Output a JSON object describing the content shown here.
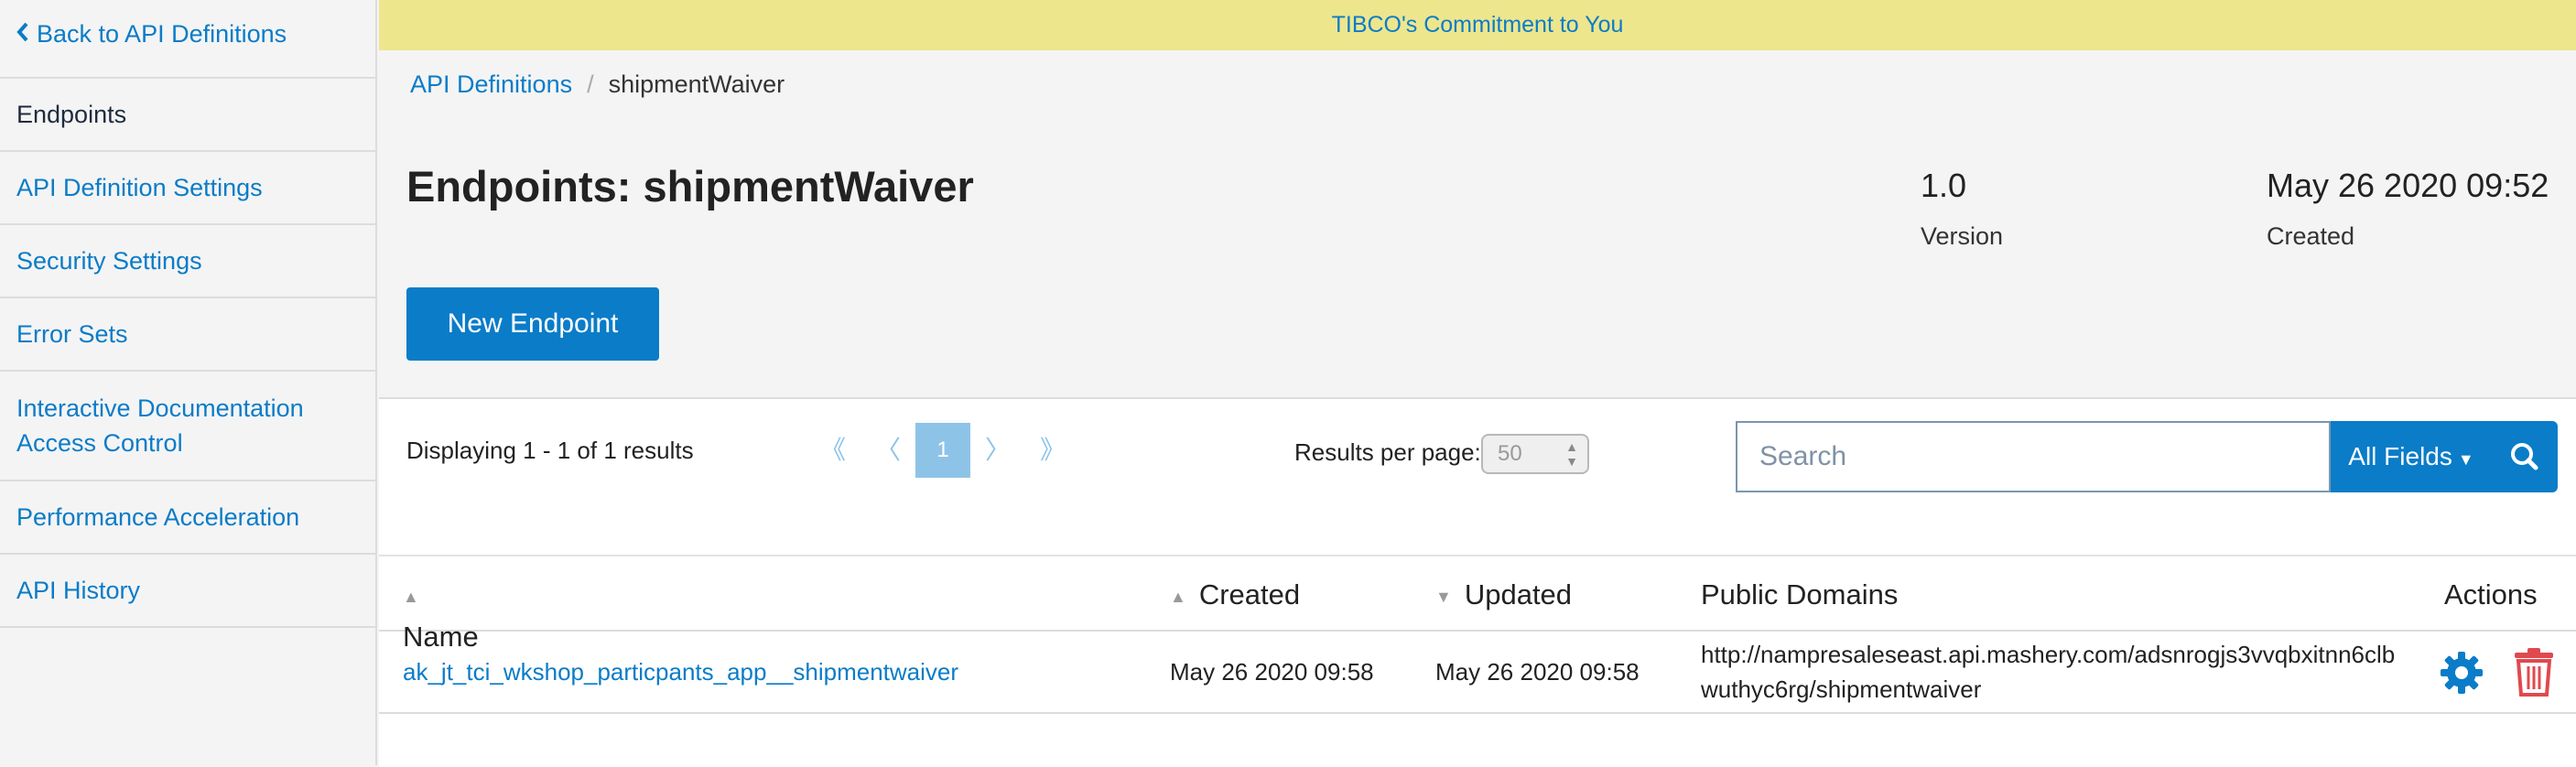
{
  "sidebar": {
    "back_label": "Back to API Definitions",
    "items": [
      {
        "label": "Endpoints"
      },
      {
        "label": "API Definition Settings"
      },
      {
        "label": "Security Settings"
      },
      {
        "label": "Error Sets"
      },
      {
        "label": "Interactive Documentation\nAccess Control"
      },
      {
        "label": "Performance Acceleration"
      },
      {
        "label": "API History"
      }
    ]
  },
  "banner": {
    "text": "TIBCO's Commitment to You"
  },
  "breadcrumb": {
    "parent": "API Definitions",
    "separator": "/",
    "current": "shipmentWaiver"
  },
  "page": {
    "title": "Endpoints: shipmentWaiver",
    "version_value": "1.0",
    "version_label": "Version",
    "created_value": "May 26 2020 09:52",
    "created_label": "Created",
    "new_button": "New Endpoint"
  },
  "listing": {
    "displaying": "Displaying 1 - 1 of 1 results",
    "pager": {
      "first": "《",
      "prev": "〈",
      "current": "1",
      "next": "〉",
      "last": "》"
    },
    "results_per_page_label": "Results per page:",
    "results_per_page_value": "50",
    "search_placeholder": "Search",
    "search_value": "",
    "all_fields_label": "All Fields"
  },
  "table": {
    "columns": {
      "name": "Name",
      "created": "Created",
      "updated": "Updated",
      "public_domains": "Public Domains",
      "actions": "Actions"
    },
    "rows": [
      {
        "name": "ak_jt_tci_wkshop_particpants_app__shipmentwaiver",
        "created": "May 26 2020 09:58",
        "updated": "May 26 2020 09:58",
        "public_domains": "http://nampresaleseast.api.mashery.com/adsnrogjs3vvqbxitnn6clbwuthyc6rg/shipmentwaiver"
      }
    ]
  },
  "colors": {
    "accent": "#0a7cc8",
    "banner": "#ede68d",
    "danger": "#e0494e",
    "pager": "#8ec3e8"
  },
  "icons": {
    "back": "chevron-left-icon",
    "search": "search-icon",
    "settings": "gear-icon",
    "delete": "trash-icon"
  }
}
